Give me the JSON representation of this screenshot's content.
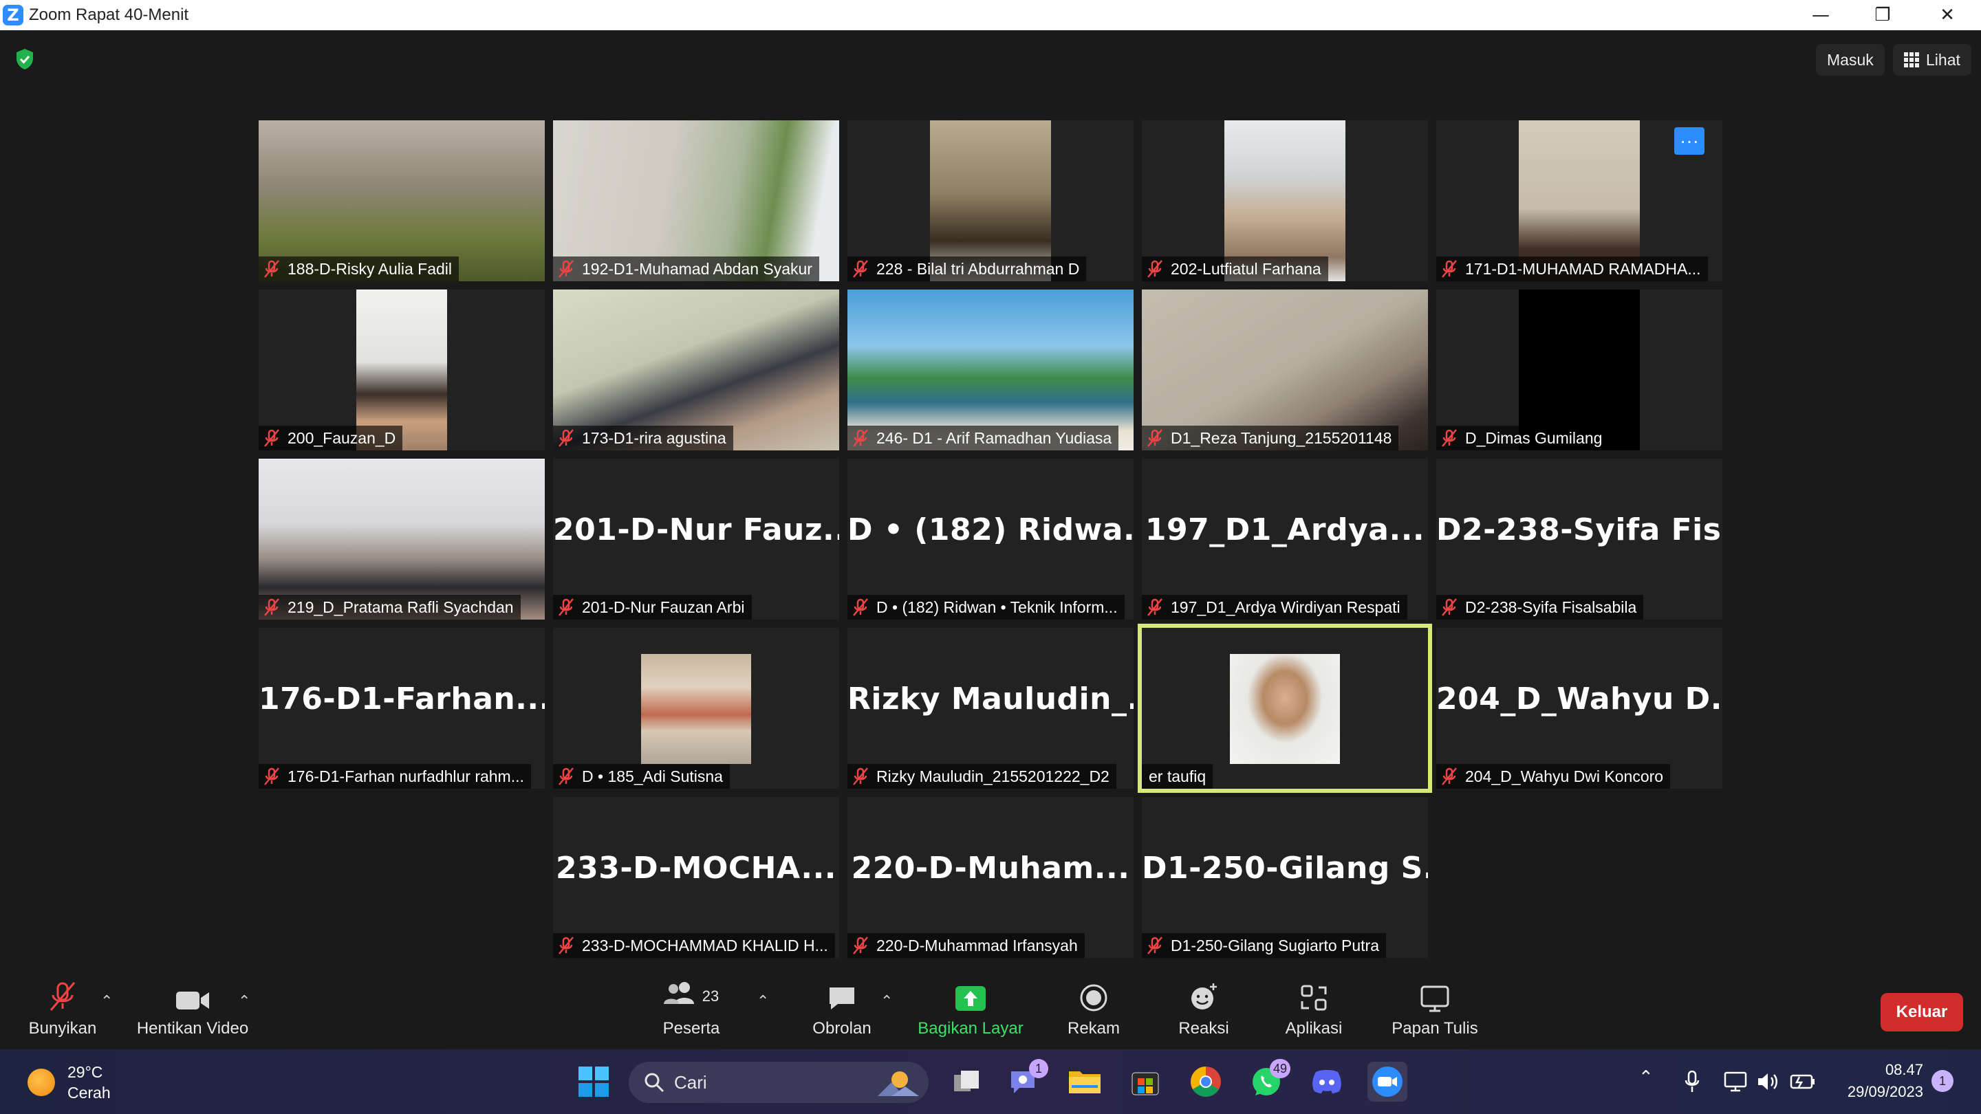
{
  "window": {
    "title": "Zoom Rapat 40-Menit",
    "minimize": "—",
    "restore": "❐",
    "close": "✕"
  },
  "top_bar": {
    "masuk_label": "Masuk",
    "lihat_label": "Lihat"
  },
  "participants": [
    {
      "name": "188-D-Risky Aulia Fadil",
      "big": ""
    },
    {
      "name": "192-D1-Muhamad Abdan Syakur",
      "big": ""
    },
    {
      "name": "228 - Bilal tri Abdurrahman D",
      "big": ""
    },
    {
      "name": "202-Lutfiatul Farhana",
      "big": ""
    },
    {
      "name": "171-D1-MUHAMAD RAMADHA...",
      "big": "",
      "more": "···"
    },
    {
      "name": "200_Fauzan_D",
      "big": ""
    },
    {
      "name": "173-D1-rira agustina",
      "big": ""
    },
    {
      "name": "246- D1 - Arif Ramadhan Yudiasa",
      "big": ""
    },
    {
      "name": "D1_Reza Tanjung_2155201148",
      "big": ""
    },
    {
      "name": "D_Dimas Gumilang",
      "big": ""
    },
    {
      "name": "219_D_Pratama Rafli Syachdan",
      "big": ""
    },
    {
      "name": "201-D-Nur Fauzan Arbi",
      "big": "201-D-Nur  Fauz..."
    },
    {
      "name": "D • (182) Ridwan • Teknik Inform...",
      "big": "D • (182)  Ridwa..."
    },
    {
      "name": "197_D1_Ardya Wirdiyan Respati",
      "big": "197_D1_Ardya..."
    },
    {
      "name": "D2-238-Syifa Fisalsabila",
      "big": "D2-238-Syifa  Fis..."
    },
    {
      "name": "176-D1-Farhan nurfadhlur rahm...",
      "big": "176-D1-Farhan..."
    },
    {
      "name": "D • 185_Adi Sutisna",
      "big": ""
    },
    {
      "name": "Rizky Mauludin_2155201222_D2",
      "big": "Rizky  Mauludin_..."
    },
    {
      "name": "er taufiq",
      "big": ""
    },
    {
      "name": "204_D_Wahyu Dwi Koncoro",
      "big": "204_D_Wahyu  D..."
    },
    {
      "name": "233-D-MOCHAMMAD KHALID H...",
      "big": "233-D-MOCHA..."
    },
    {
      "name": "220-D-Muhammad Irfansyah",
      "big": "220-D-Muham..."
    },
    {
      "name": "D1-250-Gilang Sugiarto Putra",
      "big": "D1-250-Gilang  S..."
    }
  ],
  "toolbar": {
    "unmute_label": "Bunyikan",
    "stop_video_label": "Hentikan Video",
    "participants_label": "Peserta",
    "participants_count": "23",
    "chat_label": "Obrolan",
    "share_label": "Bagikan Layar",
    "record_label": "Rekam",
    "reactions_label": "Reaksi",
    "apps_label": "Aplikasi",
    "whiteboard_label": "Papan Tulis",
    "leave_label": "Keluar",
    "caret": "⌃"
  },
  "taskbar": {
    "temperature": "29°C",
    "condition": "Cerah",
    "search_placeholder": "Cari",
    "teams_badge": "1",
    "whatsapp_badge": "49",
    "time": "08.47",
    "date": "29/09/2023",
    "notifications": "1"
  },
  "colors": {
    "active_speaker": "#d5e87a",
    "share_green": "#3ee06a",
    "leave_red": "#d12d2d",
    "zoom_blue": "#2d8cff"
  }
}
